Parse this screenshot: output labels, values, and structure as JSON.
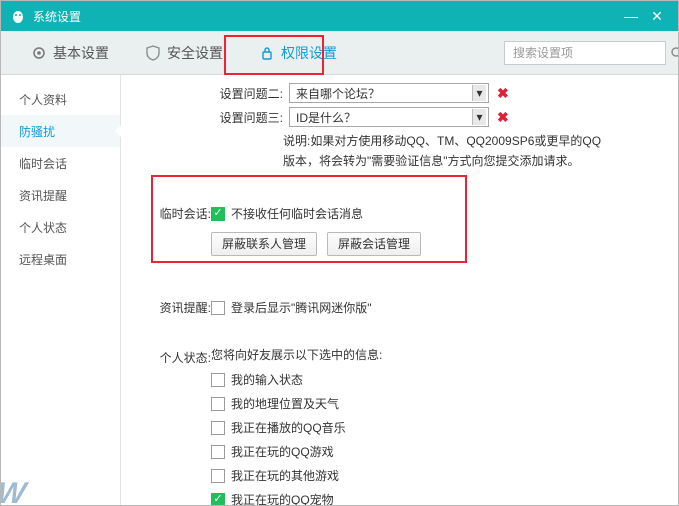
{
  "window": {
    "title": "系统设置"
  },
  "tabs": {
    "basic": "基本设置",
    "security": "安全设置",
    "permission": "权限设置"
  },
  "search": {
    "placeholder": "搜索设置项"
  },
  "sidebar": {
    "items": [
      {
        "label": "个人资料"
      },
      {
        "label": "防骚扰"
      },
      {
        "label": "临时会话"
      },
      {
        "label": "资讯提醒"
      },
      {
        "label": "个人状态"
      },
      {
        "label": "远程桌面"
      }
    ]
  },
  "questions": {
    "q2_label": "设置问题二:",
    "q2_value": "来自哪个论坛？",
    "q3_label": "设置问题三:",
    "q3_value": "ID是什么？",
    "desc": "说明:如果对方使用移动QQ、TM、QQ2009SP6或更早的QQ版本，将会转为\"需要验证信息\"方式向您提交添加请求。"
  },
  "temp_session": {
    "label": "临时会话:",
    "checkbox": "不接收任何临时会话消息",
    "btn1": "屏蔽联系人管理",
    "btn2": "屏蔽会话管理"
  },
  "news": {
    "label": "资讯提醒:",
    "checkbox": "登录后显示\"腾讯网迷你版\""
  },
  "status": {
    "label": "个人状态:",
    "intro": "您将向好友展示以下选中的信息:",
    "items": [
      {
        "label": "我的输入状态",
        "checked": false
      },
      {
        "label": "我的地理位置及天气",
        "checked": false
      },
      {
        "label": "我正在播放的QQ音乐",
        "checked": false
      },
      {
        "label": "我正在玩的QQ游戏",
        "checked": false
      },
      {
        "label": "我正在玩的其他游戏",
        "checked": false
      },
      {
        "label": "我正在玩的QQ宠物",
        "checked": true
      }
    ]
  }
}
